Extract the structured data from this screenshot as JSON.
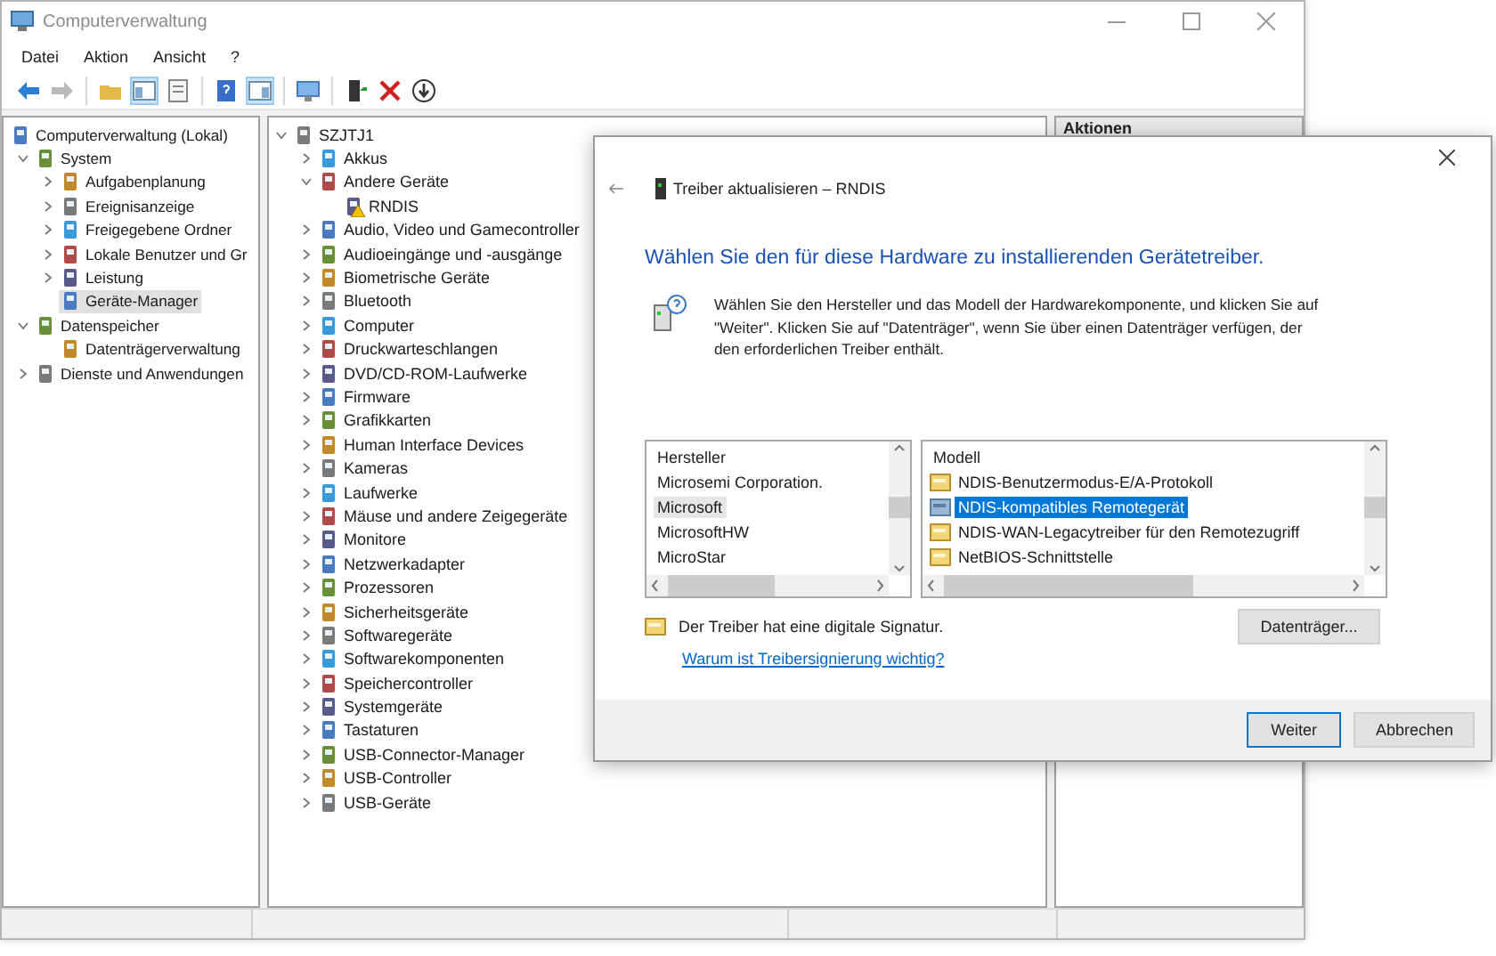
{
  "window": {
    "title": "Computerverwaltung"
  },
  "menu": [
    "Datei",
    "Aktion",
    "Ansicht",
    "?"
  ],
  "toolbar": [
    [
      {
        "disabled": false,
        "pressed": false
      },
      {
        "disabled": true,
        "pressed": false
      }
    ],
    [
      {
        "disabled": false,
        "pressed": false
      },
      {
        "disabled": false,
        "pressed": true
      },
      {
        "disabled": false,
        "pressed": false
      }
    ],
    [
      {
        "disabled": false,
        "pressed": false
      },
      {
        "disabled": false,
        "pressed": true
      }
    ],
    [
      {
        "disabled": false,
        "pressed": false
      }
    ],
    [
      {
        "disabled": false,
        "pressed": false
      },
      {
        "disabled": false,
        "pressed": false
      },
      {
        "disabled": false,
        "pressed": false
      }
    ]
  ],
  "console_tree": {
    "label": "Computerverwaltung (Lokal)",
    "selected": false,
    "children": [
      {
        "label": "System",
        "expanded": true,
        "selected": false,
        "children": [
          {
            "label": "Aufgabenplanung",
            "expanded": false,
            "selected": false
          },
          {
            "label": "Ereignisanzeige",
            "expanded": false,
            "selected": false
          },
          {
            "label": "Freigegebene Ordner",
            "expanded": false,
            "selected": false
          },
          {
            "label": "Lokale Benutzer und Gr",
            "expanded": false,
            "selected": false
          },
          {
            "label": "Leistung",
            "expanded": false,
            "selected": false
          },
          {
            "label": "Geräte-Manager",
            "selected": true
          }
        ]
      },
      {
        "label": "Datenspeicher",
        "expanded": true,
        "selected": false,
        "children": [
          {
            "label": "Datenträgerverwaltung",
            "selected": false
          }
        ]
      },
      {
        "label": "Dienste und Anwendungen",
        "expanded": false,
        "selected": false
      }
    ]
  },
  "device_tree": {
    "label": "SZJTJ1",
    "expanded": true,
    "children": [
      {
        "label": "Akkus",
        "expanded": false
      },
      {
        "label": "Andere Geräte",
        "expanded": true,
        "children": [
          {
            "label": "RNDIS",
            "warning": true
          }
        ]
      },
      {
        "label": "Audio, Video und Gamecontroller",
        "expanded": false
      },
      {
        "label": "Audioeingänge und -ausgänge",
        "expanded": false
      },
      {
        "label": "Biometrische Geräte",
        "expanded": false
      },
      {
        "label": "Bluetooth",
        "expanded": false
      },
      {
        "label": "Computer",
        "expanded": false
      },
      {
        "label": "Druckwarteschlangen",
        "expanded": false
      },
      {
        "label": "DVD/CD-ROM-Laufwerke",
        "expanded": false
      },
      {
        "label": "Firmware",
        "expanded": false
      },
      {
        "label": "Grafikkarten",
        "expanded": false
      },
      {
        "label": "Human Interface Devices",
        "expanded": false
      },
      {
        "label": "Kameras",
        "expanded": false
      },
      {
        "label": "Laufwerke",
        "expanded": false
      },
      {
        "label": "Mäuse und andere Zeigegeräte",
        "expanded": false
      },
      {
        "label": "Monitore",
        "expanded": false
      },
      {
        "label": "Netzwerkadapter",
        "expanded": false
      },
      {
        "label": "Prozessoren",
        "expanded": false
      },
      {
        "label": "Sicherheitsgeräte",
        "expanded": false
      },
      {
        "label": "Softwaregeräte",
        "expanded": false
      },
      {
        "label": "Softwarekomponenten",
        "expanded": false
      },
      {
        "label": "Speichercontroller",
        "expanded": false
      },
      {
        "label": "Systemgeräte",
        "expanded": false
      },
      {
        "label": "Tastaturen",
        "expanded": false
      },
      {
        "label": "USB-Connector-Manager",
        "expanded": false
      },
      {
        "label": "USB-Controller",
        "expanded": false
      },
      {
        "label": "USB-Geräte",
        "expanded": false
      }
    ]
  },
  "actions_pane": {
    "title": "Aktionen"
  },
  "dialog": {
    "title": "Treiber aktualisieren – RNDIS",
    "heading": "Wählen Sie den für diese Hardware zu installierenden Gerätetreiber.",
    "description": "Wählen Sie den Hersteller und das Modell der Hardwarekomponente, und klicken Sie auf \"Weiter\". Klicken Sie auf \"Datenträger\", wenn Sie über einen Datenträger verfügen, der den erforderlichen Treiber enthält.",
    "manufacturers": {
      "header": "Hersteller",
      "focused": false,
      "items": [
        {
          "label": "Microsemi Corporation.",
          "selected": false
        },
        {
          "label": "Microsoft",
          "selected": true
        },
        {
          "label": "MicrosoftHW",
          "selected": false
        },
        {
          "label": "MicroStar",
          "selected": false
        }
      ]
    },
    "models": {
      "header": "Modell",
      "focused": true,
      "items": [
        {
          "label": "NDIS-Benutzermodus-E/A-Protokoll",
          "selected": false
        },
        {
          "label": "NDIS-kompatibles Remotegerät",
          "selected": true
        },
        {
          "label": "NDIS-WAN-Legacytreiber für den Remotezugriff",
          "selected": false
        },
        {
          "label": "NetBIOS-Schnittstelle",
          "selected": false
        }
      ]
    },
    "signature": "Der Treiber hat eine digitale Signatur.",
    "signature_link": "Warum ist Treibersignierung wichtig?",
    "disk_button": "Datenträger...",
    "buttons": [
      {
        "label": "Weiter",
        "default": true
      },
      {
        "label": "Abbrechen",
        "default": false
      }
    ]
  }
}
